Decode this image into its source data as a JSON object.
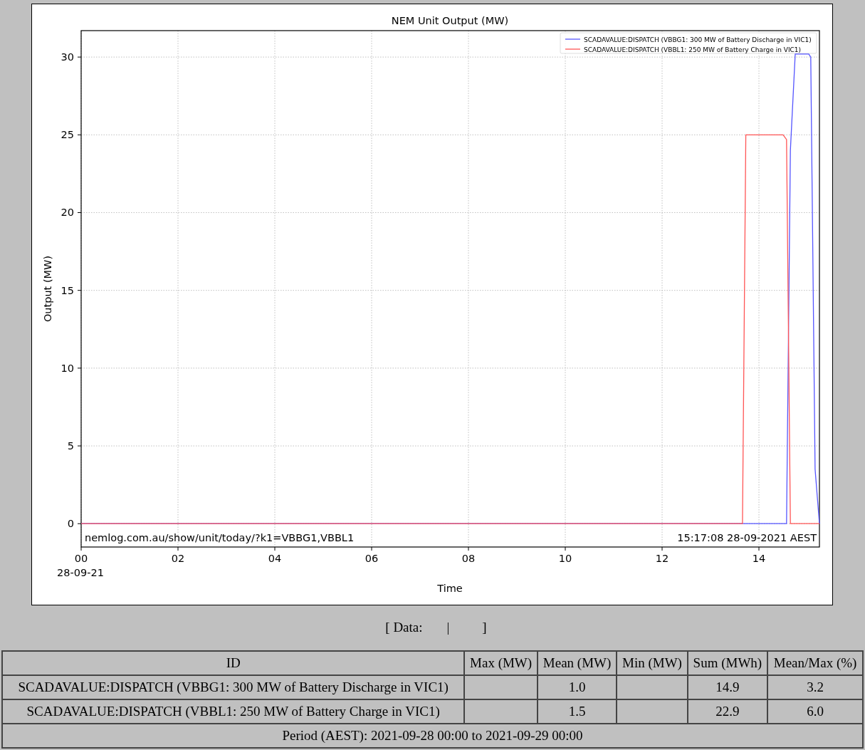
{
  "chart": {
    "chart_data": {
      "type": "line",
      "title": "NEM Unit Output (MW)",
      "xlabel": "Time",
      "ylabel": "Output (MW)",
      "x": [
        0,
        13.66,
        13.73,
        14.5,
        14.57,
        14.65,
        14.75,
        15.03,
        15.07,
        15.16,
        15.25
      ],
      "series": [
        {
          "name": "SCADAVALUE:DISPATCH (VBBG1: 300 MW of Battery Discharge in VIC1)",
          "color": "#5555ff",
          "values": [
            0,
            0,
            0,
            0,
            0,
            24,
            30.2,
            30.2,
            30,
            3.5,
            0
          ]
        },
        {
          "name": "SCADAVALUE:DISPATCH (VBBL1: 250 MW of Battery Charge in VIC1)",
          "color": "#ff5555",
          "values": [
            0,
            0,
            25,
            25,
            24.7,
            0,
            0,
            0,
            0,
            0,
            0
          ]
        }
      ],
      "xlim": [
        0,
        15.25
      ],
      "ylim": [
        -1.5,
        31.7
      ],
      "xticks": [
        {
          "value": 0,
          "label": "00"
        },
        {
          "value": 2,
          "label": "02"
        },
        {
          "value": 4,
          "label": "04"
        },
        {
          "value": 6,
          "label": "06"
        },
        {
          "value": 8,
          "label": "08"
        },
        {
          "value": 10,
          "label": "10"
        },
        {
          "value": 12,
          "label": "12"
        },
        {
          "value": 14,
          "label": "14"
        }
      ],
      "yticks": [
        0,
        5,
        10,
        15,
        20,
        25,
        30
      ],
      "grid": true,
      "legend": true,
      "annotations": [
        "nemlog.com.au/show/unit/today/?k1=VBBG1,VBBL1",
        "15:17:08 28-09-2021 AEST"
      ]
    },
    "date_label": "28-09-21"
  },
  "data_links": {
    "open": "[ Data:",
    "separator": "|",
    "close": "]"
  },
  "table": {
    "columns": [
      "ID",
      "Max (MW)",
      "Mean (MW)",
      "Min (MW)",
      "Sum (MWh)",
      "Mean/Max (%)"
    ],
    "rows": [
      {
        "id": "SCADAVALUE:DISPATCH (VBBG1: 300 MW of Battery Discharge in VIC1)",
        "mean": "1.0",
        "sum": "14.9",
        "mean_max": "3.2"
      },
      {
        "id": "SCADAVALUE:DISPATCH (VBBL1: 250 MW of Battery Charge in VIC1)",
        "mean": "1.5",
        "sum": "22.9",
        "mean_max": "6.0"
      }
    ],
    "footer": "Period (AEST): 2021-09-28 00:00 to 2021-09-29 00:00"
  }
}
